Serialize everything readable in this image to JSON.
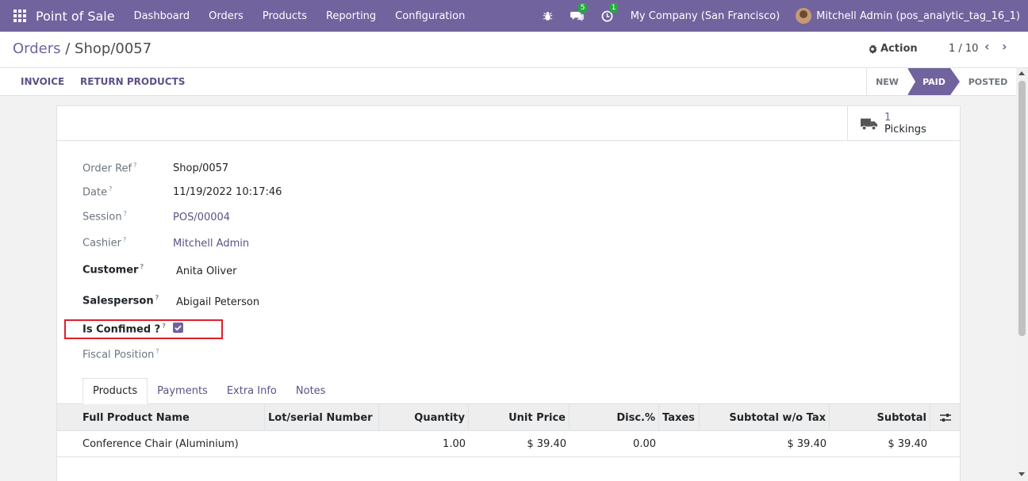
{
  "navbar": {
    "brand": "Point of Sale",
    "menu": [
      "Dashboard",
      "Orders",
      "Products",
      "Reporting",
      "Configuration"
    ],
    "messages_count": "5",
    "activities_count": "1",
    "company": "My Company (San Francisco)",
    "user": "Mitchell Admin (pos_analytic_tag_16_1)"
  },
  "breadcrumb": {
    "parent": "Orders",
    "separator": " / ",
    "current": "Shop/0057"
  },
  "control": {
    "action_label": "Action",
    "pager": "1 / 10"
  },
  "statusbar": {
    "buttons": [
      "INVOICE",
      "RETURN PRODUCTS"
    ],
    "stages": [
      {
        "label": "NEW",
        "active": false
      },
      {
        "label": "PAID",
        "active": true
      },
      {
        "label": "POSTED",
        "active": false
      }
    ]
  },
  "smart_button": {
    "count": "1",
    "label": "Pickings"
  },
  "fields": {
    "order_ref": {
      "label": "Order Ref",
      "value": "Shop/0057"
    },
    "date": {
      "label": "Date",
      "value": "11/19/2022 10:17:46"
    },
    "session": {
      "label": "Session",
      "value": "POS/00004"
    },
    "cashier": {
      "label": "Cashier",
      "value": "Mitchell Admin"
    },
    "customer": {
      "label": "Customer",
      "value": "Anita Oliver"
    },
    "salesperson": {
      "label": "Salesperson",
      "value": "Abigail Peterson"
    },
    "is_confirmed": {
      "label": "Is Confimed ?",
      "checked": true
    },
    "fiscal_position": {
      "label": "Fiscal Position",
      "value": ""
    }
  },
  "tabs": [
    "Products",
    "Payments",
    "Extra Info",
    "Notes"
  ],
  "table": {
    "headers": [
      "Full Product Name",
      "Lot/serial Number",
      "Quantity",
      "Unit Price",
      "Disc.%",
      "Taxes",
      "Subtotal w/o Tax",
      "Subtotal"
    ],
    "rows": [
      [
        "Conference Chair (Aluminium)",
        "",
        "1.00",
        "$ 39.40",
        "0.00",
        "",
        "$ 39.40",
        "$ 39.40"
      ]
    ]
  },
  "colors": {
    "brand": "#71639e",
    "highlight": "#e0202b"
  }
}
